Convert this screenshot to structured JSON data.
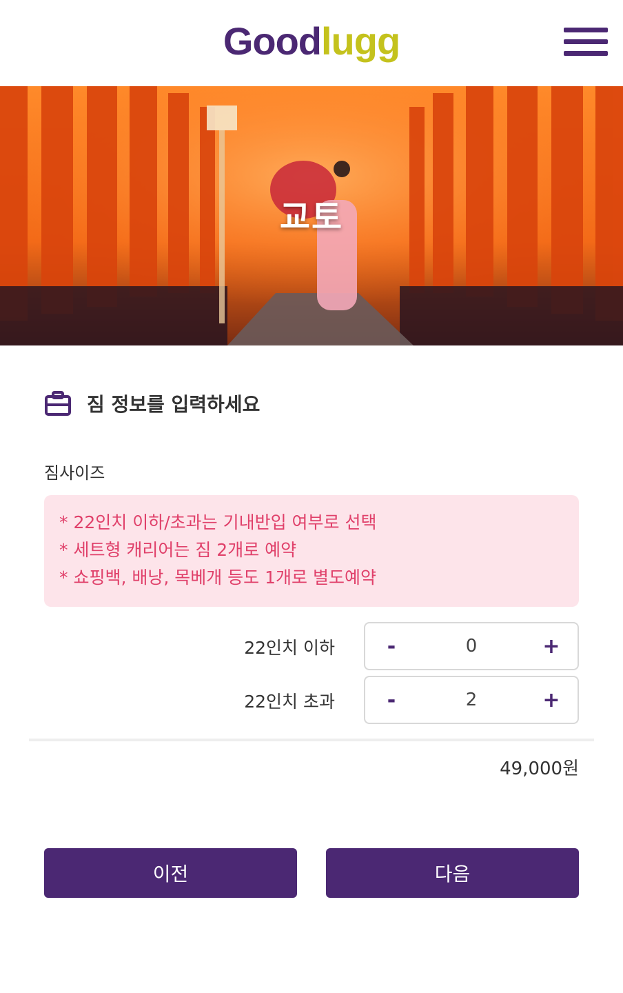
{
  "header": {
    "logo_part1": "Good",
    "logo_part2": "lugg",
    "menu_icon": "hamburger-menu-icon"
  },
  "hero": {
    "city": "교토",
    "image_description_icon": "torii-gate-photo"
  },
  "luggage_section": {
    "title": "짐 정보를 입력하세요",
    "icon": "briefcase-icon",
    "size_label": "짐사이즈",
    "notices": [
      "* 22인치 이하/초과는 기내반입 여부로 선택",
      "* 세트형 캐리어는 짐 2개로 예약",
      "* 쇼핑백, 배낭, 목베개 등도 1개로 별도예약"
    ],
    "items": [
      {
        "label": "22인치 이하",
        "quantity": "0"
      },
      {
        "label": "22인치 초과",
        "quantity": "2"
      }
    ],
    "minus_label": "-",
    "plus_label": "+",
    "total": "49,000원"
  },
  "footer_buttons": {
    "prev": "이전",
    "next": "다음"
  },
  "colors": {
    "brand_purple": "#4b2873",
    "brand_lime": "#c4c21d",
    "notice_bg": "#fde4ea",
    "notice_text": "#e0406a"
  }
}
